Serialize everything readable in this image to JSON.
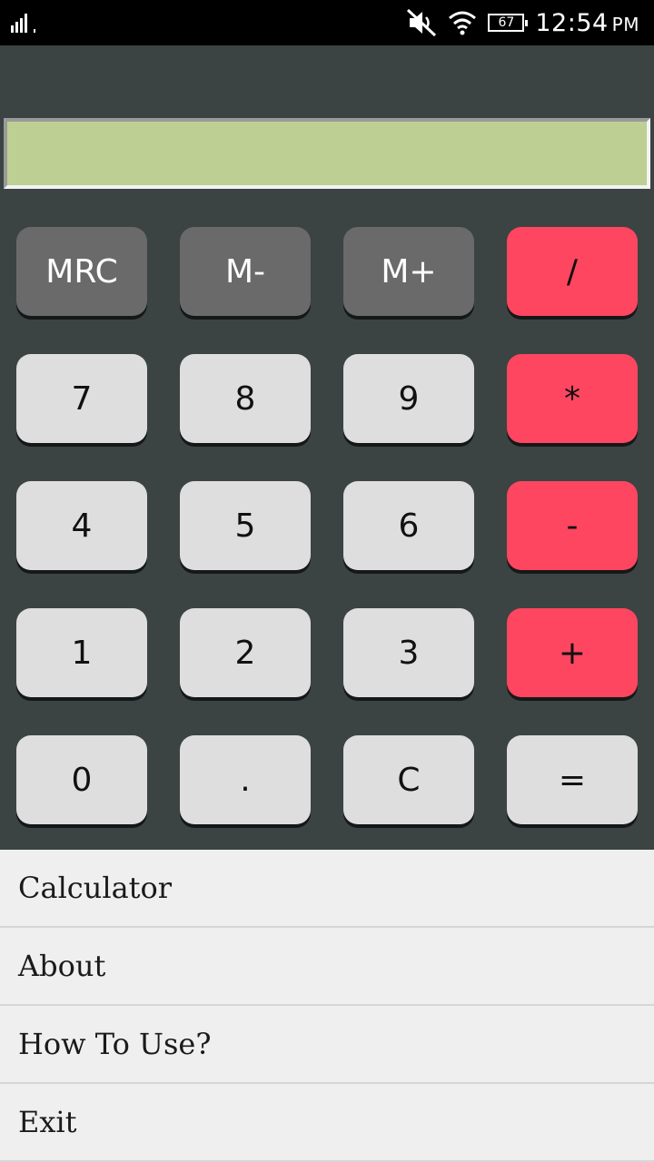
{
  "status_bar": {
    "battery": "67",
    "time": "12:54",
    "ampm": "PM",
    "icons": [
      "signal-icon",
      "mute-icon",
      "wifi-icon",
      "battery-icon"
    ]
  },
  "display": {
    "value": ""
  },
  "keypad": {
    "rows": [
      [
        "MRC",
        "M-",
        "M+",
        "/"
      ],
      [
        "7",
        "8",
        "9",
        "*"
      ],
      [
        "4",
        "5",
        "6",
        "-"
      ],
      [
        "1",
        "2",
        "3",
        "+"
      ],
      [
        "0",
        ".",
        "C",
        "="
      ]
    ]
  },
  "menu": {
    "items": [
      "Calculator",
      "About",
      "How To Use?",
      "Exit"
    ]
  },
  "colors": {
    "background": "#3c4343",
    "display": "#bdcf93",
    "number_key": "#dedede",
    "memory_key": "#6a6a6a",
    "operator_key": "#ff4660",
    "menu_background": "#efefef"
  }
}
